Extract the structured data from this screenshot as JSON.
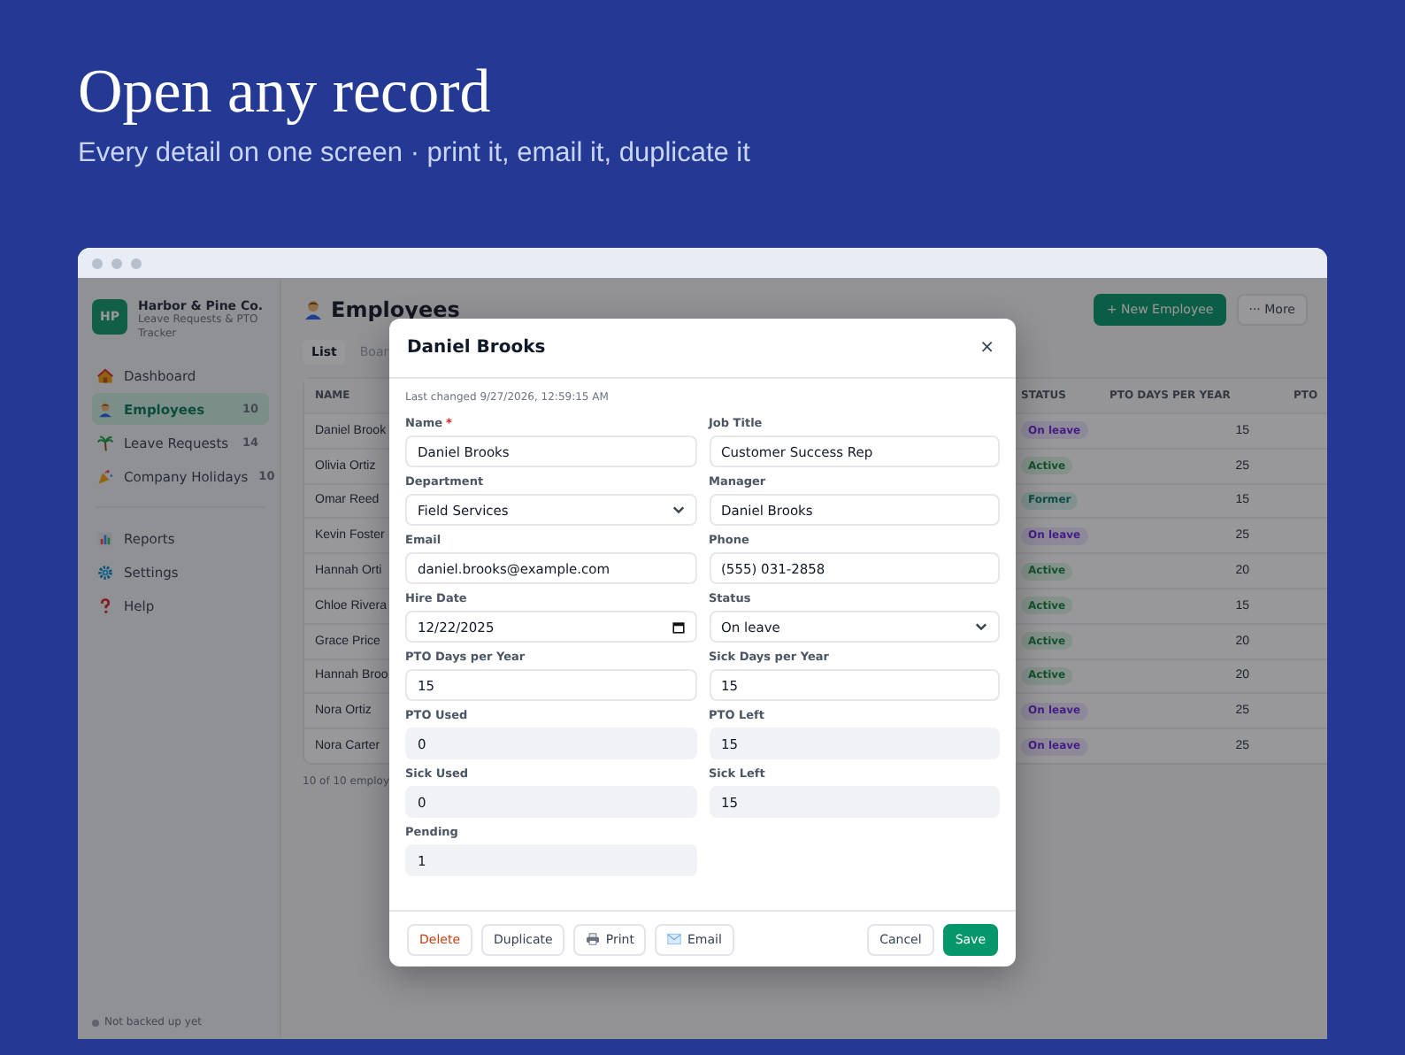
{
  "hero": {
    "title": "Open any record",
    "subtitle": "Every detail on one screen · print it, email it, duplicate it"
  },
  "sidebar": {
    "logo": "HP",
    "company": "Harbor & Pine Co.",
    "tagline": "Leave Requests & PTO Tracker",
    "sections": [
      {
        "items": [
          {
            "label": "Dashboard",
            "selected": false
          },
          {
            "label": "Employees",
            "count": "10",
            "selected": true
          },
          {
            "label": "Leave Requests",
            "count": "14",
            "selected": false
          },
          {
            "label": "Company Holidays",
            "count": "10",
            "selected": false
          }
        ]
      },
      {
        "items": [
          {
            "label": "Reports",
            "selected": false
          },
          {
            "label": "Settings",
            "selected": false
          },
          {
            "label": "Help",
            "selected": false
          }
        ]
      }
    ],
    "backup_status": "Not backed up yet"
  },
  "main": {
    "title": "Employees",
    "actions": [
      {
        "label": "+ New Employee",
        "kind": "primary"
      },
      {
        "label": "··· More",
        "kind": "secondary"
      }
    ],
    "view_tabs": [
      {
        "label": "List",
        "selected": true
      },
      {
        "label": "Boar",
        "selected": false
      }
    ],
    "table": {
      "columns": [
        "NAME",
        "STATUS",
        "PTO DAYS PER YEAR",
        "PTO"
      ],
      "rows": [
        {
          "name": "Daniel Brook",
          "status": "On leave",
          "kind": "leave",
          "pto_days": "15"
        },
        {
          "name": "Olivia Ortiz",
          "status": "Active",
          "kind": "active",
          "pto_days": "25"
        },
        {
          "name": "Omar Reed",
          "status": "Former",
          "kind": "former",
          "pto_days": "15"
        },
        {
          "name": "Kevin Foster",
          "status": "On leave",
          "kind": "leave",
          "pto_days": "25"
        },
        {
          "name": "Hannah Orti",
          "status": "Active",
          "kind": "active",
          "pto_days": "20"
        },
        {
          "name": "Chloe Rivera",
          "status": "Active",
          "kind": "active",
          "pto_days": "15"
        },
        {
          "name": "Grace Price",
          "status": "Active",
          "kind": "active",
          "pto_days": "20"
        },
        {
          "name": "Hannah Broo",
          "status": "Active",
          "kind": "active",
          "pto_days": "20"
        },
        {
          "name": "Nora Ortiz",
          "status": "On leave",
          "kind": "leave",
          "pto_days": "25"
        },
        {
          "name": "Nora Carter",
          "status": "On leave",
          "kind": "leave",
          "pto_days": "25"
        }
      ],
      "footer": "10 of 10 employ"
    }
  },
  "modal": {
    "title": "Daniel Brooks",
    "close": "×",
    "last_changed": "Last changed 9/27/2026, 12:59:15 AM",
    "fields": [
      {
        "label": "Name",
        "required_mark": "*",
        "kind": "text",
        "value": "Daniel Brooks"
      },
      {
        "label": "Job Title",
        "kind": "text",
        "value": "Customer Success Rep"
      },
      {
        "label": "Department",
        "kind": "select",
        "value": "Field Services"
      },
      {
        "label": "Manager",
        "kind": "text",
        "value": "Daniel Brooks"
      },
      {
        "label": "Email",
        "kind": "text",
        "value": "daniel.brooks@example.com"
      },
      {
        "label": "Phone",
        "kind": "text",
        "value": "(555) 031-2858"
      },
      {
        "label": "Hire Date",
        "kind": "date",
        "value": "12/22/2025"
      },
      {
        "label": "Status",
        "kind": "select",
        "value": "On leave"
      },
      {
        "label": "PTO Days per Year",
        "kind": "text",
        "value": "15"
      },
      {
        "label": "Sick Days per Year",
        "kind": "text",
        "value": "15"
      },
      {
        "label": "PTO Used",
        "kind": "readonly",
        "value": "0"
      },
      {
        "label": "PTO Left",
        "kind": "readonly",
        "value": "15"
      },
      {
        "label": "Sick Used",
        "kind": "readonly",
        "value": "0"
      },
      {
        "label": "Sick Left",
        "kind": "readonly",
        "value": "15"
      },
      {
        "label": "Pending",
        "kind": "readonly",
        "value": "1"
      }
    ],
    "left_actions": [
      {
        "label": "Delete",
        "kind": "danger"
      },
      {
        "label": "Duplicate",
        "kind": "plain"
      },
      {
        "label": "Print",
        "kind": "print"
      },
      {
        "label": "Email",
        "kind": "email"
      }
    ],
    "right_actions": [
      {
        "label": "Cancel",
        "kind": "plain"
      },
      {
        "label": "Save",
        "kind": "primary"
      }
    ]
  }
}
